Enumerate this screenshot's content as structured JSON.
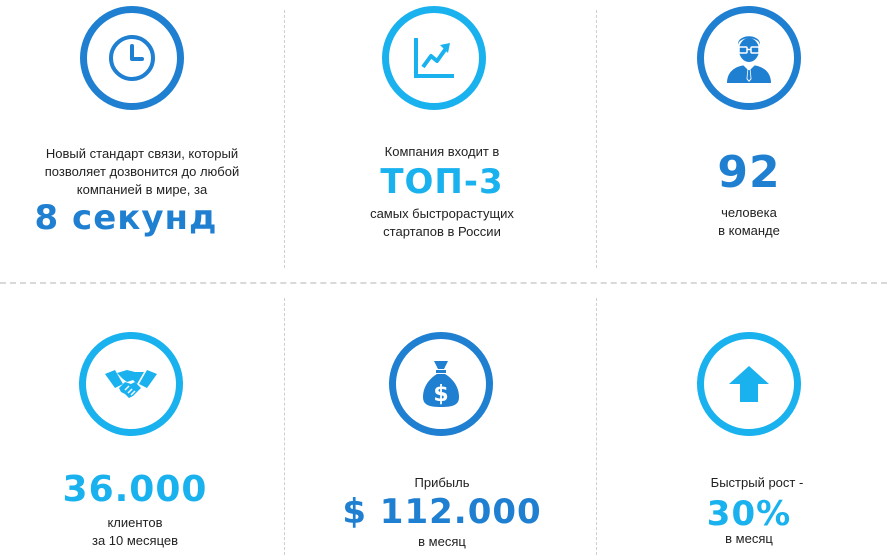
{
  "colors": {
    "dark_blue": "#1f7fd1",
    "light_blue": "#19b1ee",
    "divider": "#d9d9d9"
  },
  "stats": {
    "s1": {
      "icon": "clock-icon",
      "line1": "Новый стандарт связи, который",
      "line2": "позволяет дозвонится до любой",
      "line3": "компанией в мире, за",
      "big": "8 секунд"
    },
    "s2": {
      "icon": "growth-chart-icon",
      "top": "Компания входит в",
      "big": "ТОП-3",
      "line1": "самых быстрорастущих",
      "line2": "стартапов в России"
    },
    "s3": {
      "icon": "businessman-icon",
      "big": "92",
      "line1": "человека",
      "line2": "в команде"
    },
    "s4": {
      "icon": "handshake-icon",
      "big": "36.000",
      "line1": "клиентов",
      "line2": "за 10 месяцев"
    },
    "s5": {
      "icon": "money-bag-icon",
      "top": "Прибыль",
      "big": "$ 112.000",
      "line1": "в месяц"
    },
    "s6": {
      "icon": "arrow-up-icon",
      "top": "Быстрый рост -",
      "big": "30%",
      "line1": "в месяц"
    }
  }
}
